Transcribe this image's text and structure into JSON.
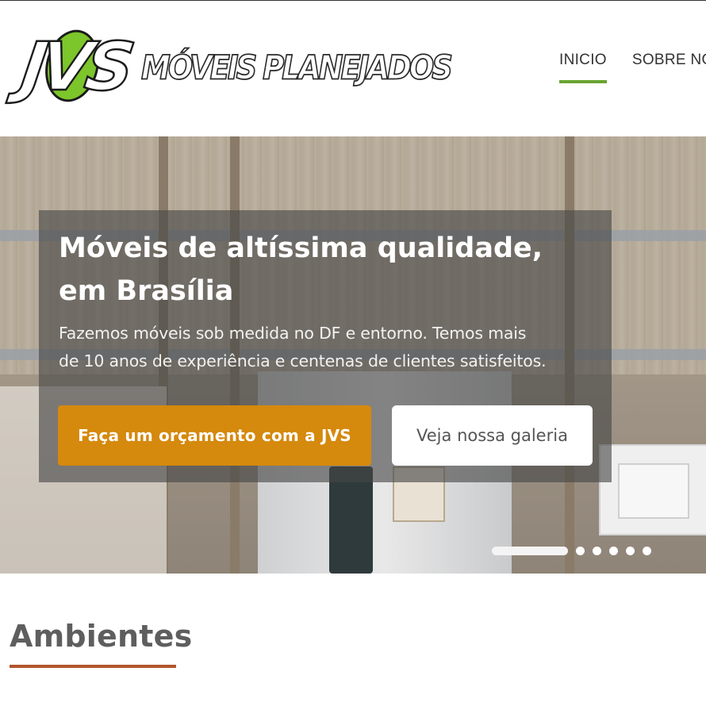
{
  "brand": {
    "logo_mark": "JVS",
    "logo_text": "MÓVEIS PLANEJADOS",
    "logo_green": "#7cc52b"
  },
  "nav": {
    "items": [
      {
        "label": "INICIO",
        "active": true
      },
      {
        "label": "SOBRE NÓS",
        "active": false
      }
    ],
    "active_color": "#6aa430"
  },
  "hero": {
    "title_line1": "Móveis de altíssima qualidade,",
    "title_line2": "em Brasília",
    "desc_line1": "Fazemos móveis sob medida no DF e entorno. Temos mais",
    "desc_line2": "de 10 anos de experiência e centenas de clientes satisfeitos.",
    "cta_primary": "Faça um orçamento com a JVS",
    "cta_secondary": "Veja nossa galeria",
    "primary_color": "#d5890d",
    "carousel": {
      "slides": 6,
      "active": 1
    }
  },
  "section": {
    "title": "Ambientes",
    "underline_color": "#b3552a"
  }
}
